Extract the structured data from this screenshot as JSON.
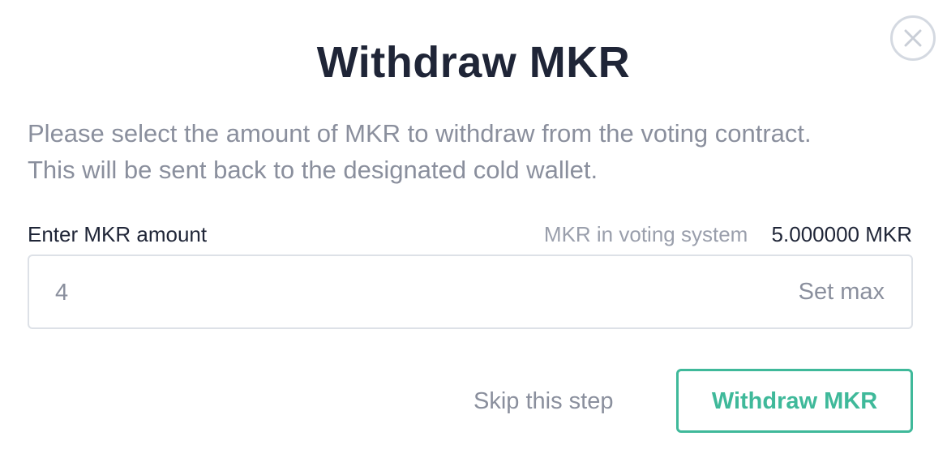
{
  "modal": {
    "title": "Withdraw MKR",
    "description": "Please select the amount of MKR to withdraw from the voting contract. This will be sent back to the designated cold wallet.",
    "close_icon": "close-icon"
  },
  "form": {
    "amount_label": "Enter MKR amount",
    "balance_label": "MKR in voting system",
    "balance_value": "5.000000 MKR",
    "amount_value": "4",
    "set_max_label": "Set max"
  },
  "actions": {
    "skip_label": "Skip this step",
    "withdraw_label": "Withdraw MKR"
  },
  "colors": {
    "accent": "#3fb99a",
    "title_text": "#1f2537",
    "muted_text": "#8a8f9d",
    "border": "#dde1e7"
  }
}
